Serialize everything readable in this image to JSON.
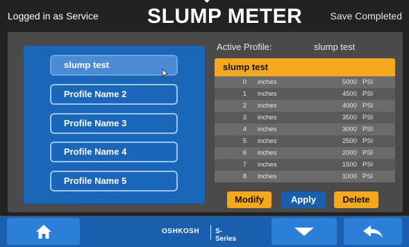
{
  "header": {
    "logged_in": "Logged in as Service",
    "title": "SLUMP METER",
    "status": "Save Completed"
  },
  "profiles": {
    "items": [
      {
        "label": "slump test",
        "selected": true
      },
      {
        "label": "Profile Name 2",
        "selected": false
      },
      {
        "label": "Profile Name 3",
        "selected": false
      },
      {
        "label": "Profile Name 4",
        "selected": false
      },
      {
        "label": "Profile Name 5",
        "selected": false
      }
    ]
  },
  "active_profile": {
    "label": "Active Profile:",
    "value": "slump test"
  },
  "table": {
    "title": "slump test",
    "rows": [
      {
        "depth": "0",
        "depth_unit": "inches",
        "pressure": "5000",
        "pressure_unit": "PSI"
      },
      {
        "depth": "1",
        "depth_unit": "inches",
        "pressure": "4500",
        "pressure_unit": "PSI"
      },
      {
        "depth": "2",
        "depth_unit": "inches",
        "pressure": "4000",
        "pressure_unit": "PSI"
      },
      {
        "depth": "3",
        "depth_unit": "inches",
        "pressure": "3500",
        "pressure_unit": "PSI"
      },
      {
        "depth": "4",
        "depth_unit": "inches",
        "pressure": "3000",
        "pressure_unit": "PSI"
      },
      {
        "depth": "5",
        "depth_unit": "inches",
        "pressure": "2500",
        "pressure_unit": "PSI"
      },
      {
        "depth": "6",
        "depth_unit": "inches",
        "pressure": "2000",
        "pressure_unit": "PSI"
      },
      {
        "depth": "7",
        "depth_unit": "inches",
        "pressure": "1500",
        "pressure_unit": "PSI"
      },
      {
        "depth": "8",
        "depth_unit": "inches",
        "pressure": "1000",
        "pressure_unit": "PSI"
      }
    ]
  },
  "actions": {
    "modify": "Modify",
    "apply": "Apply",
    "delete": "Delete"
  },
  "footer": {
    "brand": "OSHKOSH",
    "series": "S-Series",
    "icons": [
      "home-icon",
      "chevron-down-icon",
      "back-arrow-icon"
    ]
  },
  "colors": {
    "accent_orange": "#f4a81b",
    "accent_blue": "#1a66b8",
    "background": "#222222",
    "panel": "#4a4a4a"
  }
}
